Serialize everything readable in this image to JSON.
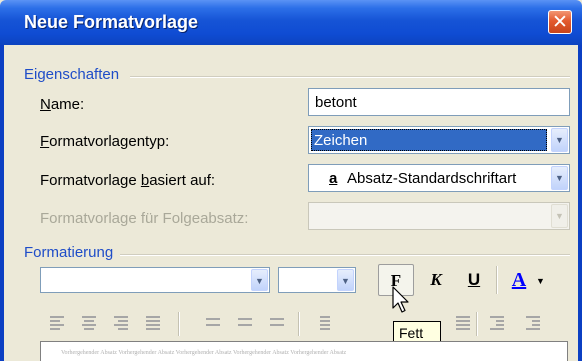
{
  "window": {
    "title": "Neue Formatvorlage",
    "close_glyph": "✕"
  },
  "properties": {
    "section_label": "Eigenschaften",
    "name": {
      "label_u": "N",
      "label_rest": "ame:",
      "value": "betont"
    },
    "type": {
      "label_u": "F",
      "label_rest": "ormatvorlagentyp:",
      "value": "Zeichen"
    },
    "based_on": {
      "label_before": "Formatvorlage ",
      "label_u": "b",
      "label_rest": "asiert auf:",
      "icon_glyph": "a",
      "value": "Absatz-Standardschriftart"
    },
    "next": {
      "label": "Formatvorlage für Folgeabsatz:",
      "value": ""
    }
  },
  "formatting": {
    "section_label": "Formatierung",
    "font_name": "",
    "font_size": "",
    "bold_label": "F",
    "italic_label": "K",
    "underline_label": "U",
    "color_label": "A",
    "tooltip": "Fett",
    "preview_text": "Vorhergehender Absatz Vorhergehender Absatz Vorhergehender Absatz Vorhergehender Absatz Vorhergehender Absatz"
  },
  "colors": {
    "accent_blue": "#316ac5",
    "font_color": "#0000ff",
    "title_blue": "#0f4cd3"
  },
  "icons": {
    "dropdown": "▼"
  }
}
